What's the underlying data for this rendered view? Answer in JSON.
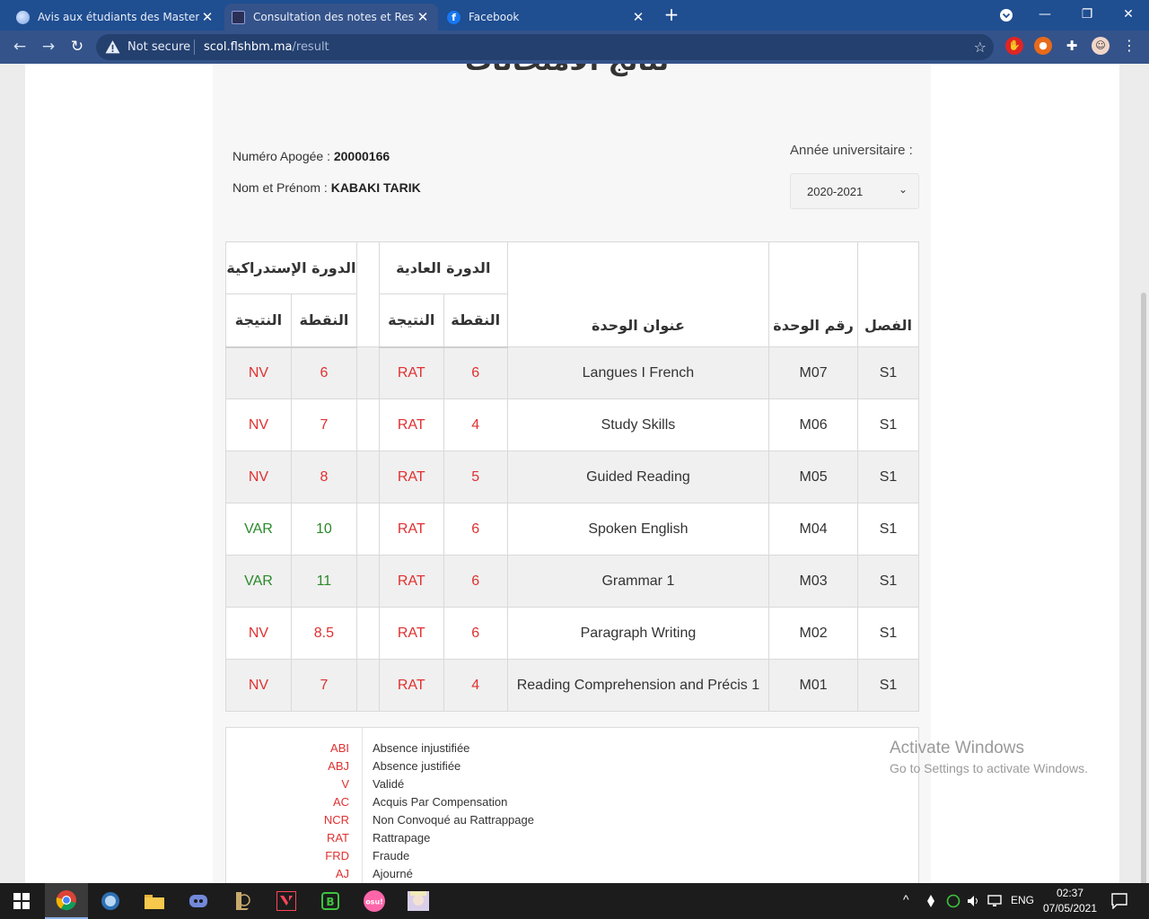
{
  "browser": {
    "tabs": [
      {
        "label": "Avis aux étudiants des Masters - ",
        "close": "✕",
        "active": false
      },
      {
        "label": "Consultation des notes et Resulta",
        "close": "✕",
        "active": true
      },
      {
        "label": "Facebook",
        "close": "✕",
        "active": false
      }
    ],
    "new_tab": "+",
    "window_controls": {
      "minimize": "—",
      "restore": "❐",
      "close": "✕"
    },
    "nav": {
      "back": "←",
      "forward": "→",
      "reload": "↻"
    },
    "security_label": "Not secure",
    "url_host": "scol.flshbm.ma",
    "url_path": "/result",
    "bookmark_icon": "☆",
    "menu_icon": "⋮"
  },
  "page": {
    "heading": "نتائج الامتحانات",
    "apogee_label": "Numéro Apogée : ",
    "apogee_value": "20000166",
    "name_label": "Nom et Prénom : ",
    "name_value": "KABAKI TARIK",
    "year_label": "Année universitaire :",
    "year_value": "2020-2021",
    "year_caret": "⌄"
  },
  "table": {
    "headers": {
      "semester": "الفصل",
      "module_code": "رقم الوحدة",
      "module_title": "عنوان الوحدة",
      "ordinary_session": "الدورة العادية",
      "catchup_session": "الدورة الإستدراكية",
      "grade": "النقطة",
      "result": "النتيجة"
    },
    "rows": [
      {
        "semester": "S1",
        "code": "M07",
        "title": "Langues I French",
        "grade1": "6",
        "result1": "RAT",
        "grade2": "6",
        "result2": "NV"
      },
      {
        "semester": "S1",
        "code": "M06",
        "title": "Study Skills",
        "grade1": "4",
        "result1": "RAT",
        "grade2": "7",
        "result2": "NV"
      },
      {
        "semester": "S1",
        "code": "M05",
        "title": "Guided Reading",
        "grade1": "5",
        "result1": "RAT",
        "grade2": "8",
        "result2": "NV"
      },
      {
        "semester": "S1",
        "code": "M04",
        "title": "Spoken English",
        "grade1": "6",
        "result1": "RAT",
        "grade2": "10",
        "result2": "VAR"
      },
      {
        "semester": "S1",
        "code": "M03",
        "title": "Grammar 1",
        "grade1": "6",
        "result1": "RAT",
        "grade2": "11",
        "result2": "VAR"
      },
      {
        "semester": "S1",
        "code": "M02",
        "title": "Paragraph Writing",
        "grade1": "6",
        "result1": "RAT",
        "grade2": "8.5",
        "result2": "NV"
      },
      {
        "semester": "S1",
        "code": "M01",
        "title": "Reading Comprehension and Précis 1",
        "grade1": "4",
        "result1": "RAT",
        "grade2": "7",
        "result2": "NV"
      }
    ]
  },
  "legend": [
    {
      "code": "ABI",
      "desc": "Absence injustifiée"
    },
    {
      "code": "ABJ",
      "desc": "Absence justifiée"
    },
    {
      "code": "V",
      "desc": "Validé"
    },
    {
      "code": "AC",
      "desc": "Acquis Par Compensation"
    },
    {
      "code": "NCR",
      "desc": "Non Convoqué au Rattrappage"
    },
    {
      "code": "RAT",
      "desc": "Rattrapage"
    },
    {
      "code": "FRD",
      "desc": "Fraude"
    },
    {
      "code": "AJ",
      "desc": "Ajourné"
    }
  ],
  "watermark": {
    "line1": "Activate Windows",
    "line2": "Go to Settings to activate Windows."
  },
  "taskbar": {
    "language": "ENG",
    "time": "02:37",
    "date": "07/05/2021",
    "tray_chevron": "^"
  },
  "colors": {
    "chrome_frame": "#1f4e91",
    "chrome_toolbar": "#34538a",
    "fail_red": "#e03030",
    "pass_green": "#2a8a2a"
  }
}
